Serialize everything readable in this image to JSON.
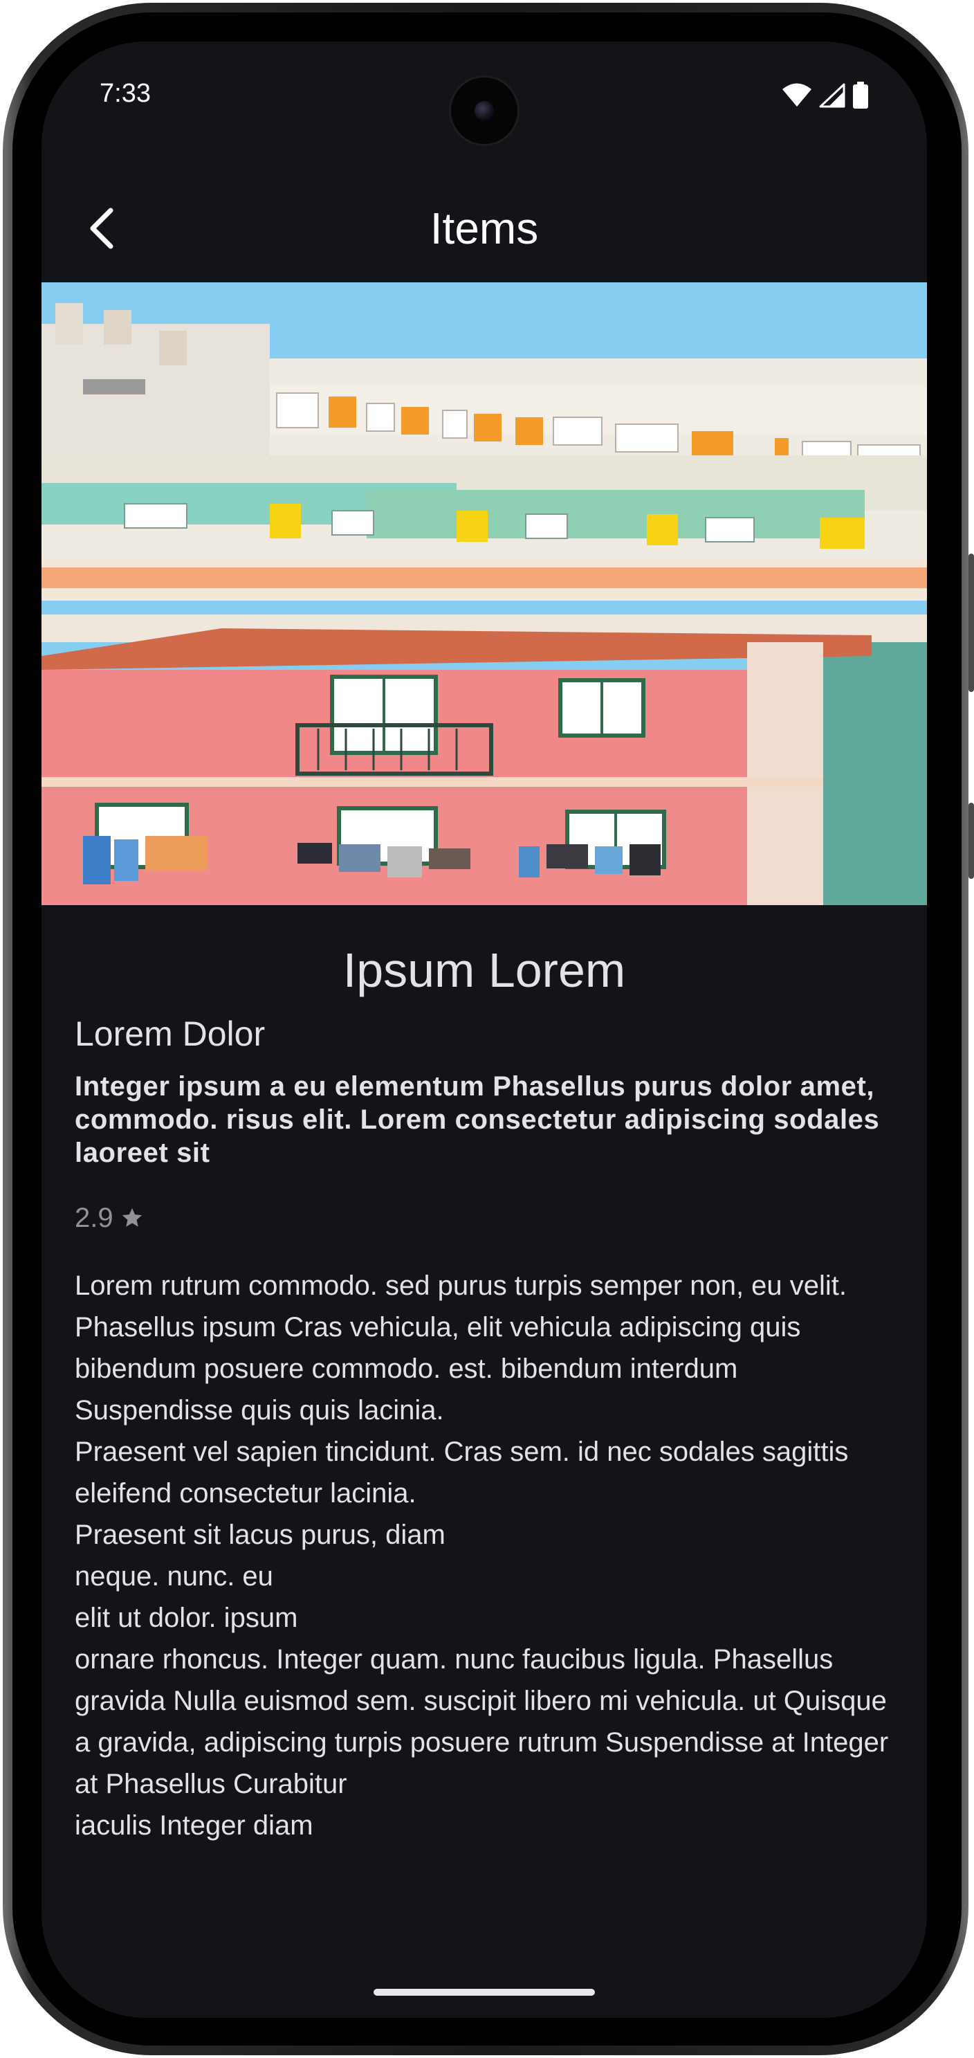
{
  "status_bar": {
    "time": "7:33",
    "icons": [
      "wifi-icon",
      "cellular-signal-icon",
      "battery-icon"
    ]
  },
  "app_bar": {
    "title": "Items",
    "back_icon": "arrow-back-icon"
  },
  "hero_image": {
    "subject": "pastel-colored building facade with balconies and laundry"
  },
  "item": {
    "title": "Ipsum Lorem",
    "subtitle": "Lorem Dolor",
    "summary": "Integer ipsum a eu elementum Phasellus purus dolor amet, commodo. risus elit. Lorem consectetur adipiscing sodales\nlaoreet sit",
    "rating": "2.9",
    "rating_icon": "star-icon",
    "description": "Lorem rutrum commodo. sed purus turpis semper non, eu velit.\nPhasellus ipsum Cras vehicula, elit vehicula adipiscing quis bibendum posuere commodo. est. bibendum interdum Suspendisse quis quis lacinia.\nPraesent vel sapien tincidunt. Cras sem. id nec sodales sagittis eleifend consectetur lacinia.\nPraesent sit lacus purus, diam\nneque. nunc. eu\nelit ut dolor. ipsum\nornare rhoncus. Integer quam. nunc faucibus ligula. Phasellus gravida Nulla euismod sem. suscipit libero mi vehicula. ut Quisque a gravida, adipiscing turpis posuere rutrum Suspendisse at Integer at Phasellus Curabitur\niaculis Integer diam"
  },
  "colors": {
    "background": "#131318",
    "on_background": "#e4e1e8",
    "muted_text": "#93909a",
    "frame": "#1a1a1a"
  }
}
